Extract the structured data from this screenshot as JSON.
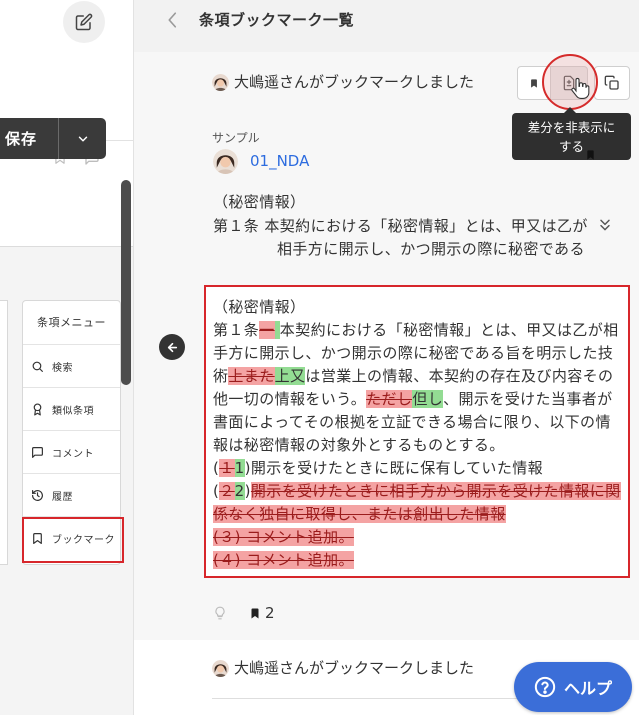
{
  "app": {
    "edit_icon": "pencil-square-icon"
  },
  "editor": {
    "save_label": "保存",
    "toolbar_icons": [
      "bookmark-icon",
      "comment-icon"
    ]
  },
  "clause_menu": {
    "title": "条項メニュー",
    "items": [
      {
        "label": "検索",
        "icon": "search-icon"
      },
      {
        "label": "類似条項",
        "icon": "award-icon"
      },
      {
        "label": "コメント",
        "icon": "comment-icon"
      },
      {
        "label": "履歴",
        "icon": "history-icon"
      },
      {
        "label": "ブックマーク",
        "icon": "bookmark-icon",
        "highlighted": true
      }
    ]
  },
  "panel": {
    "title": "条項ブックマーク一覧",
    "cards": [
      {
        "actor": "大嶋遥さんがブックマークしました",
        "actions": [
          {
            "icon": "bookmark-filled-icon",
            "active": false
          },
          {
            "icon": "diff-toggle-icon",
            "active": true
          },
          {
            "icon": "copy-icon",
            "active": false
          }
        ],
        "tooltip": [
          "差分を非表示に",
          "する"
        ],
        "category": "サンプル",
        "document": "01_NDA",
        "original": {
          "heading": "（秘密情報）",
          "lines": [
            "第１条 本契約における「秘密情報」とは、甲又は乙が",
            "相手方に開示し、かつ開示の際に秘密である"
          ]
        },
        "diff": {
          "heading": "（秘密情報）",
          "lines": [
            [
              {
                "t": "第１条"
              },
              {
                "t": "一",
                "deleted": true
              },
              {
                "t": " ",
                "inserted": true
              },
              {
                "t": "本契約における「秘密情報」とは、甲又は乙が相"
              }
            ],
            [
              {
                "t": "手方に開示し、かつ開示の際に秘密である旨を明示した技"
              }
            ],
            [
              {
                "t": "術"
              },
              {
                "t": "上また",
                "deleted": true
              },
              {
                "t": "上又",
                "inserted": true
              },
              {
                "t": "は営業上の情報、本契約の存在及び内容その"
              }
            ],
            [
              {
                "t": "他一切の情報をいう。"
              },
              {
                "t": "ただし",
                "deleted": true
              },
              {
                "t": "但し",
                "inserted": true
              },
              {
                "t": "、開示を受けた当事者が"
              }
            ],
            [
              {
                "t": "書面によってその根拠を立証できる場合に限り、以下の情"
              }
            ],
            [
              {
                "t": "報は秘密情報の対象外とするものとする。"
              }
            ],
            [
              {
                "t": "("
              },
              {
                "t": "１",
                "deleted": true
              },
              {
                "t": "1",
                "inserted": true
              },
              {
                "t": ")開示を受けたときに既に保有していた情報"
              }
            ],
            [
              {
                "t": "("
              },
              {
                "t": "２",
                "deleted": true
              },
              {
                "t": "2",
                "inserted": true
              },
              {
                "t": ")"
              },
              {
                "t": "開示を受けたときに相手方から開示を受けた情報に関",
                "deleted": true
              }
            ],
            [
              {
                "t": "係なく独自に取得し、または創出した情報",
                "deleted": true
              }
            ],
            [
              {
                "t": "(３) コメント追加。",
                "deleted": true
              }
            ],
            [
              {
                "t": "(４) コメント追加。",
                "deleted": true
              }
            ]
          ]
        },
        "footer_icons": [
          "lightbulb-icon",
          "bookmark-filled-icon"
        ],
        "bookmark_count": "2"
      },
      {
        "actor": "大嶋遥さんがブックマークしました"
      }
    ]
  },
  "help": {
    "label": "ヘルプ",
    "icon": "question-circle-icon"
  },
  "colors": {
    "accent_blue": "#3b6ed8",
    "link_blue": "#2d6cdf",
    "highlight_red": "#d7262b",
    "diff_deleted": "#f4a3a3",
    "diff_inserted": "#93dc93",
    "save_button": "#3a3a3a"
  }
}
